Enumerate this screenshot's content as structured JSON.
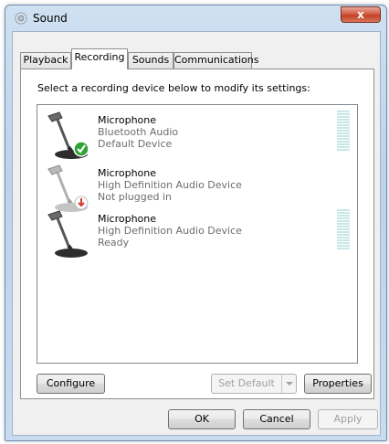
{
  "window": {
    "title": "Sound",
    "close_glyph": "x"
  },
  "tabs": [
    {
      "label": "Playback",
      "active": false
    },
    {
      "label": "Recording",
      "active": true
    },
    {
      "label": "Sounds",
      "active": false
    },
    {
      "label": "Communications",
      "active": false
    }
  ],
  "recording": {
    "instruction": "Select a recording device below to modify its settings:",
    "devices": [
      {
        "name": "Microphone",
        "device": "Bluetooth Audio",
        "status": "Default Device",
        "icon": "microphone-default-icon",
        "badge": "green-check",
        "level_meter": true
      },
      {
        "name": "Microphone",
        "device": "High Definition Audio Device",
        "status": "Not plugged in",
        "icon": "microphone-unplugged-icon",
        "badge": "red-down-arrow",
        "level_meter": false
      },
      {
        "name": "Microphone",
        "device": "High Definition Audio Device",
        "status": "Ready",
        "icon": "microphone-icon",
        "badge": "none",
        "level_meter": true
      }
    ],
    "buttons": {
      "configure": "Configure",
      "set_default": "Set Default",
      "properties": "Properties"
    }
  },
  "dialog_buttons": {
    "ok": "OK",
    "cancel": "Cancel",
    "apply": "Apply"
  },
  "colors": {
    "badge_green": "#2fa335",
    "badge_red": "#d33a32",
    "meter": "#c8e6e6"
  }
}
